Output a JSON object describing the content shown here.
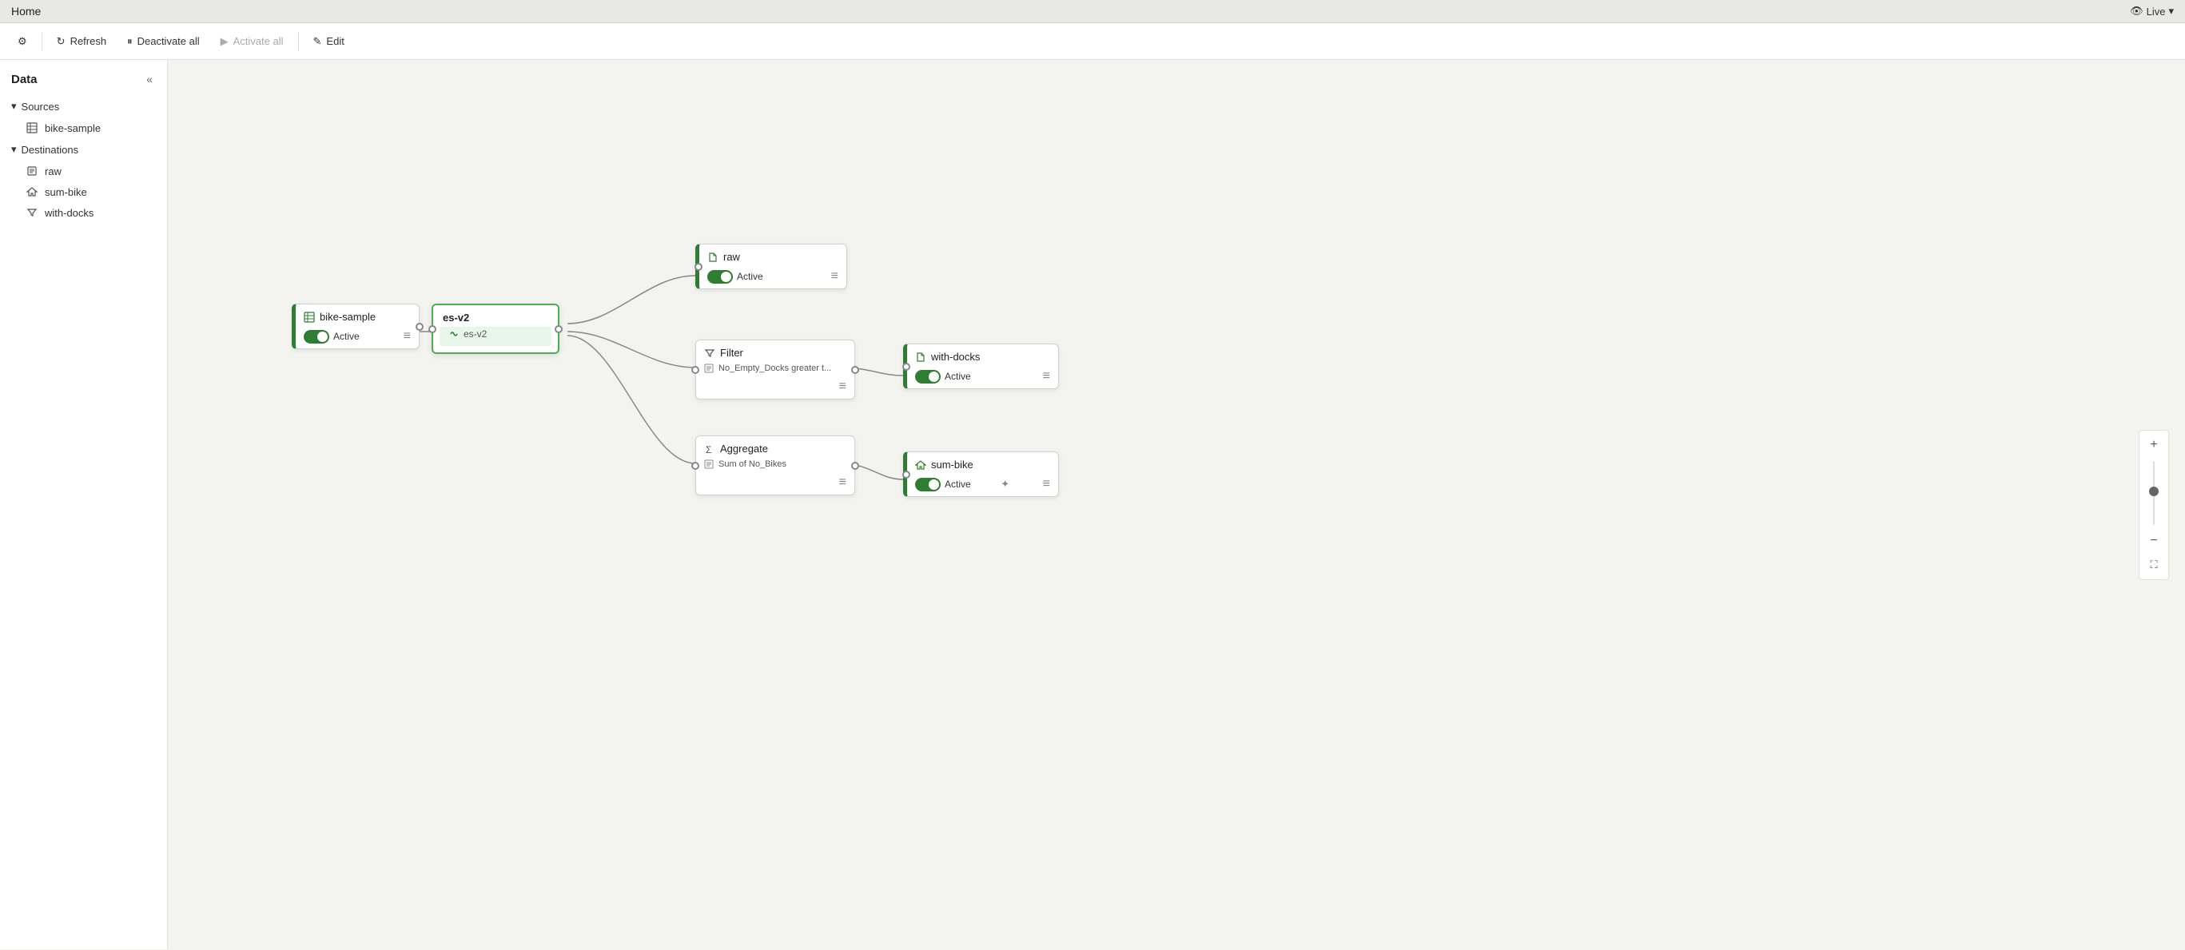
{
  "titleBar": {
    "title": "Home",
    "liveLabel": "Live"
  },
  "toolbar": {
    "settingsIcon": "⚙",
    "refreshLabel": "Refresh",
    "deactivateLabel": "Deactivate all",
    "activateLabel": "Activate all",
    "editLabel": "Edit"
  },
  "sidebar": {
    "title": "Data",
    "collapseIcon": "«",
    "sections": [
      {
        "id": "sources",
        "label": "Sources",
        "icon": "▾",
        "items": [
          {
            "id": "bike-sample",
            "label": "bike-sample",
            "iconType": "table"
          }
        ]
      },
      {
        "id": "destinations",
        "label": "Destinations",
        "icon": "▾",
        "items": [
          {
            "id": "raw",
            "label": "raw",
            "iconType": "raw"
          },
          {
            "id": "sum-bike",
            "label": "sum-bike",
            "iconType": "house"
          },
          {
            "id": "with-docks",
            "label": "with-docks",
            "iconType": "filter"
          }
        ]
      }
    ]
  },
  "nodes": {
    "bikeSample": {
      "label": "bike-sample",
      "status": "Active",
      "iconType": "table"
    },
    "esV2": {
      "label": "es-v2",
      "subLabel": "es-v2",
      "iconType": "stream"
    },
    "raw": {
      "label": "raw",
      "status": "Active",
      "iconType": "raw"
    },
    "filter": {
      "label": "Filter",
      "condition": "No_Empty_Docks greater t...",
      "iconType": "filter"
    },
    "withDocks": {
      "label": "with-docks",
      "status": "Active",
      "iconType": "raw"
    },
    "aggregate": {
      "label": "Aggregate",
      "condition": "Sum of No_Bikes",
      "iconType": "sigma"
    },
    "sumBike": {
      "label": "sum-bike",
      "status": "Active",
      "iconType": "house"
    }
  },
  "zoom": {
    "plusIcon": "+",
    "minusIcon": "−",
    "fitIcon": "⛶"
  }
}
